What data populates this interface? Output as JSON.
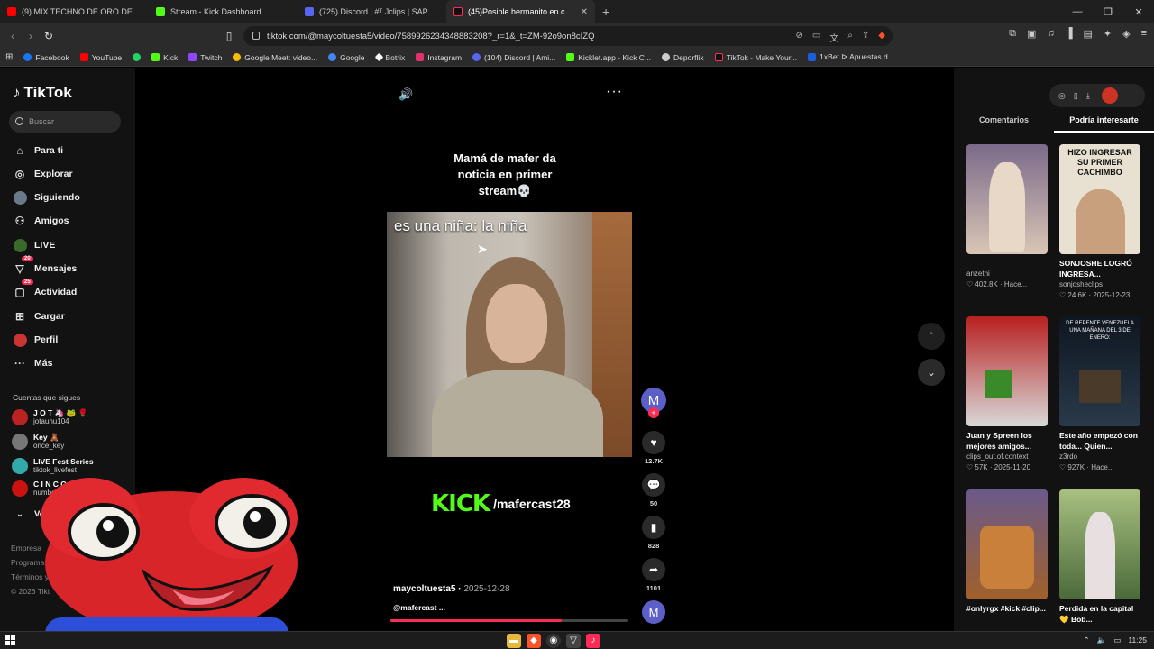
{
  "browser": {
    "tabs": [
      {
        "title": "(9) MIX TECHNO DE ORO DE 80's & 9",
        "color": "#ff0000",
        "active": false
      },
      {
        "title": "Stream - Kick Dashboard",
        "color": "#53fc18",
        "active": false
      },
      {
        "title": "(725) Discord | #ᵀ Jclips | SAPOLIC",
        "color": "#5865f2",
        "active": false
      },
      {
        "title": "(45)Posible hermanito en cam",
        "color": "#fe2c55",
        "active": true
      }
    ],
    "new_tab": "+",
    "url": "tiktok.com/@maycoltuesta5/video/7589926234348883208?_r=1&_t=ZM-92o9on8cIZQ",
    "bookmarks": [
      {
        "label": "Facebook",
        "color": "#1877f2"
      },
      {
        "label": "YouTube",
        "color": "#ff0000"
      },
      {
        "label": "",
        "color": "#25d366"
      },
      {
        "label": "Kick",
        "color": "#53fc18"
      },
      {
        "label": "Twitch",
        "color": "#9146ff"
      },
      {
        "label": "Google Meet: video...",
        "color": "#00ac47"
      },
      {
        "label": "Google",
        "color": "#fbbc05"
      },
      {
        "label": "Botrix",
        "color": "#ffffff"
      },
      {
        "label": "Instagram",
        "color": "#e1306c"
      },
      {
        "label": "(104) Discord | Ami...",
        "color": "#5865f2"
      },
      {
        "label": "Kicklet.app - Kick C...",
        "color": "#53fc18"
      },
      {
        "label": "Deporflix",
        "color": "#cccccc"
      },
      {
        "label": "TikTok - Make Your...",
        "color": "#000000"
      },
      {
        "label": "1xBet ᐅ Apuestas d...",
        "color": "#1a5ed8"
      }
    ]
  },
  "tiktok": {
    "logo": "TikTok",
    "search_placeholder": "Buscar",
    "nav": [
      {
        "label": "Para ti",
        "icon": "home-icon",
        "glyph": "⌂",
        "badge": ""
      },
      {
        "label": "Explorar",
        "icon": "compass-icon",
        "glyph": "◎",
        "badge": ""
      },
      {
        "label": "Siguiendo",
        "icon": "following-avatar-icon",
        "glyph": "●",
        "badge": ""
      },
      {
        "label": "Amigos",
        "icon": "friends-icon",
        "glyph": "👥",
        "badge": ""
      },
      {
        "label": "LIVE",
        "icon": "live-icon",
        "glyph": "●",
        "badge": ""
      },
      {
        "label": "Mensajes",
        "icon": "messages-icon",
        "glyph": "▽",
        "badge": "20"
      },
      {
        "label": "Actividad",
        "icon": "activity-icon",
        "glyph": "▢",
        "badge": "25"
      },
      {
        "label": "Cargar",
        "icon": "upload-icon",
        "glyph": "⊞",
        "badge": ""
      },
      {
        "label": "Perfil",
        "icon": "profile-icon",
        "glyph": "●",
        "badge": ""
      },
      {
        "label": "Más",
        "icon": "more-icon",
        "glyph": "···",
        "badge": ""
      }
    ],
    "following_title": "Cuentas que sigues",
    "following": [
      {
        "name": "J O T 🦄 🐸 🌹",
        "handle": "jotaunu104",
        "color": "#b22"
      },
      {
        "name": "Key 🧸",
        "handle": "once_key",
        "color": "#777"
      },
      {
        "name": "LIVE Fest Series",
        "handle": "tiktok_livefest",
        "color": "#3aa"
      },
      {
        "name": "C I N C O",
        "handle": "number_cinc0",
        "color": "#c11"
      }
    ],
    "see_more": "Ver más",
    "footer": [
      "Empresa",
      "Programa",
      "Términos y",
      "© 2026 Tikt"
    ],
    "video": {
      "caption": "Mamá de mafer da noticia en primer stream💀",
      "overlay_text": "es una niña: la niña",
      "kick_word": "KICK",
      "kick_handle": "/mafercast28",
      "author": "maycoltuesta5",
      "date": "2025-12-28",
      "mention": "@mafercast ...",
      "progress": 0.72,
      "likes": "12.7K",
      "comments": "50",
      "saves": "828",
      "shares": "1101",
      "avatar_letter": "M"
    },
    "right_tabs": [
      "Comentarios",
      "Podría interesarte"
    ],
    "cards": [
      {
        "title": "",
        "author": "anzethi",
        "meta": "♡ 402.8K · Hace...",
        "thumb_text": "",
        "bg": "#8a7a9a"
      },
      {
        "title": "SONJOSHE LOGRÓ INGRESA...",
        "author": "sonjosheclips",
        "meta": "♡ 24.6K · 2025-12-23",
        "thumb_text": "HIZO INGRESAR SU PRIMER CACHIMBO",
        "bg": "#e8e0d0"
      },
      {
        "title": "Juan y Spreen los mejores amigos...",
        "author": "clips_out.of.context",
        "meta": "♡ 57K · 2025-11-20",
        "thumb_text": "",
        "bg": "#b82020"
      },
      {
        "title": "Este año empezó con toda... Quien...",
        "author": "z3rdo",
        "meta": "♡ 927K · Hace...",
        "thumb_text": "DE REPENTE VENEZUELA UNA MAÑANA DEL 3 DE ENERO:",
        "bg": "#1e2a38"
      },
      {
        "title": "#onlyrgx #kick #clip...",
        "author": "",
        "meta": "",
        "thumb_text": "",
        "bg": "#7a4a2a"
      },
      {
        "title": "Perdida en la capital 💛 Bob...",
        "author": "",
        "meta": "",
        "thumb_text": "",
        "bg": "#5c7a4a"
      }
    ]
  },
  "taskbar": {
    "time": "11:25"
  }
}
